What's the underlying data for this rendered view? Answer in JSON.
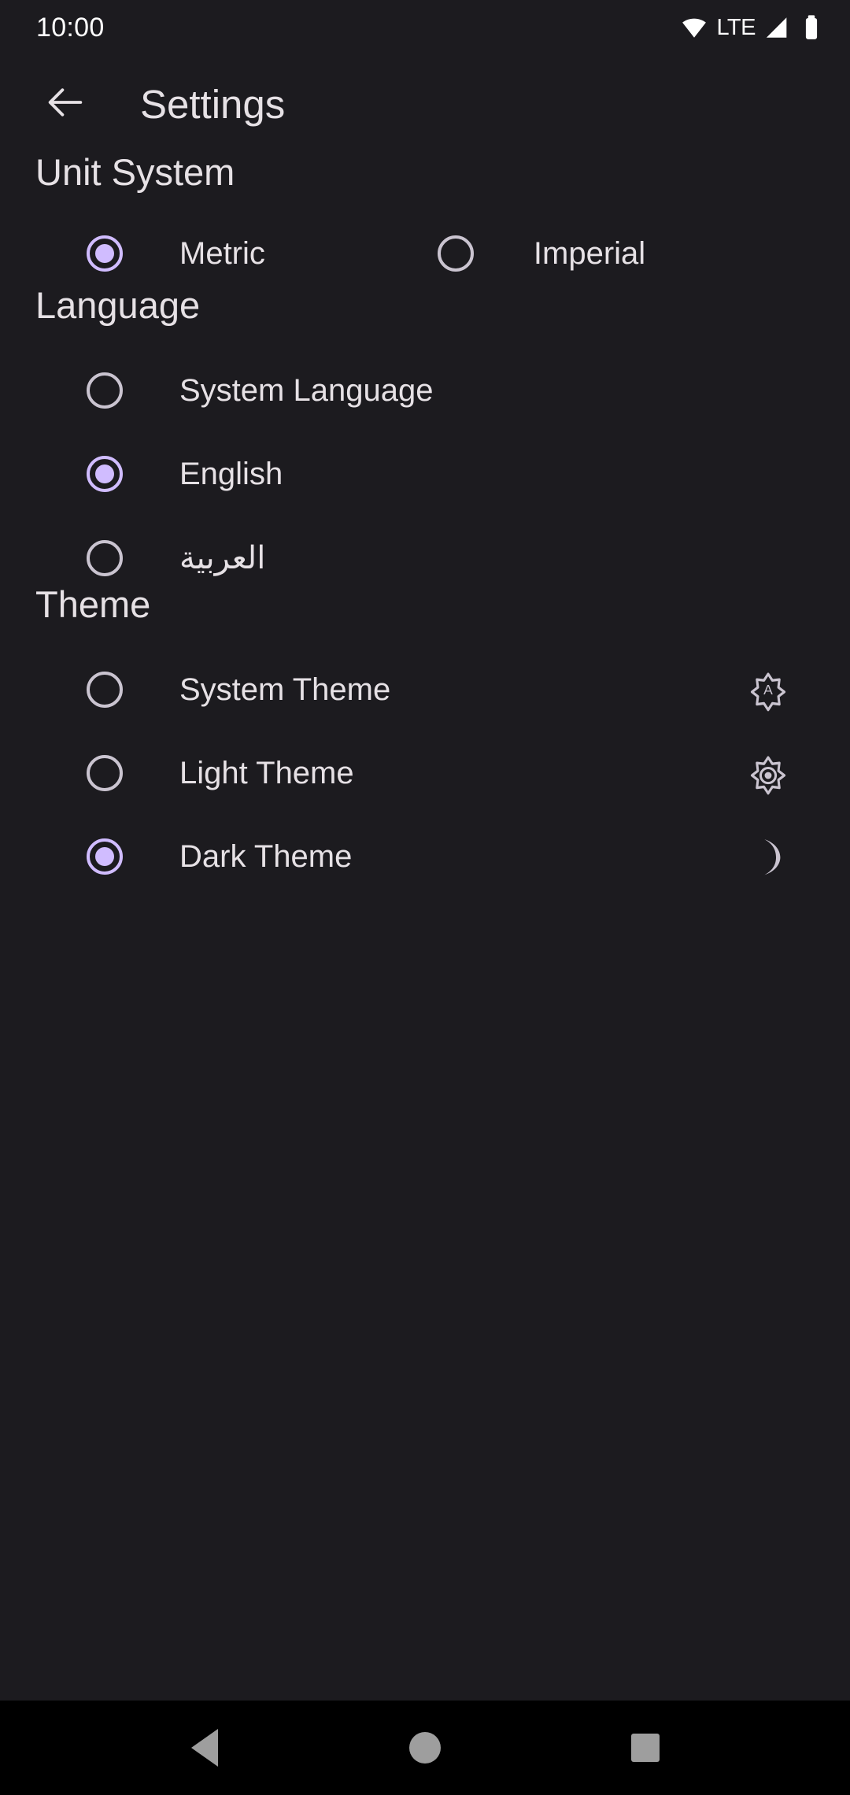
{
  "status_bar": {
    "clock": "10:00",
    "network_label": "LTE",
    "icons": [
      "wifi-icon",
      "lte-label",
      "cellular-signal-icon",
      "battery-icon"
    ]
  },
  "app_bar": {
    "back_icon": "arrow-back-icon",
    "title": "Settings"
  },
  "colors": {
    "background": "#1C1B1F",
    "on_background": "#E6E1E5",
    "accent_selected": "#D0BCFF",
    "radio_unselected": "#CAC4D0",
    "nav_bar_background": "#000000",
    "nav_icon": "#9E9E9E"
  },
  "sections": [
    {
      "id": "unit-system",
      "title": "Unit System",
      "layout": "two-column",
      "options": [
        {
          "id": "metric",
          "label": "Metric",
          "selected": true
        },
        {
          "id": "imperial",
          "label": "Imperial",
          "selected": false
        }
      ]
    },
    {
      "id": "language",
      "title": "Language",
      "layout": "list",
      "options": [
        {
          "id": "system-language",
          "label": "System Language",
          "selected": false
        },
        {
          "id": "english",
          "label": "English",
          "selected": true
        },
        {
          "id": "arabic",
          "label": "العربية",
          "selected": false
        }
      ]
    },
    {
      "id": "theme",
      "title": "Theme",
      "layout": "list",
      "options": [
        {
          "id": "system-theme",
          "label": "System Theme",
          "selected": false,
          "icon": "brightness-auto-icon"
        },
        {
          "id": "light-theme",
          "label": "Light Theme",
          "selected": false,
          "icon": "brightness-sun-icon"
        },
        {
          "id": "dark-theme",
          "label": "Dark Theme",
          "selected": true,
          "icon": "moon-crescent-icon"
        }
      ]
    }
  ],
  "nav_bar": {
    "back_label": "Back",
    "home_label": "Home",
    "recents_label": "Recents"
  }
}
